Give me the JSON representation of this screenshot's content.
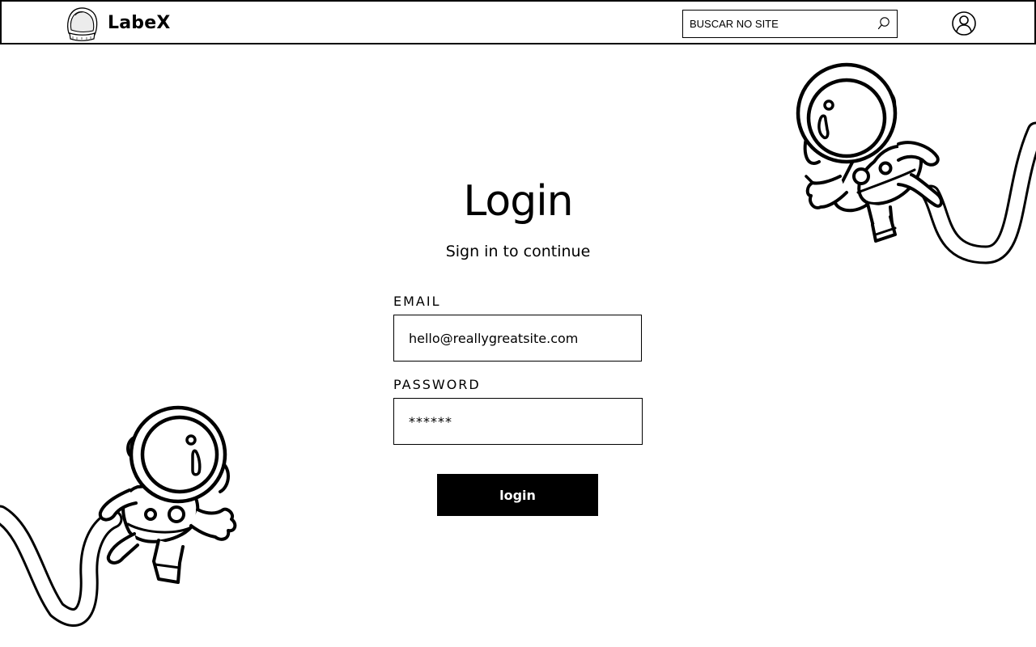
{
  "header": {
    "brand": "LabeX",
    "logo_icon": "astronaut-helmet-icon",
    "search": {
      "placeholder": "BUSCAR NO SITE",
      "icon": "search-icon"
    },
    "user_icon": "user-icon"
  },
  "login": {
    "title": "Login",
    "subtitle": "Sign in to continue",
    "email_label": "EMAIL",
    "email_value": "hello@reallygreatsite.com",
    "password_label": "PASSWORD",
    "password_value": "******",
    "submit_label": "login"
  },
  "decorations": [
    "astronaut-illustration",
    "astronaut-illustration"
  ],
  "colors": {
    "background": "#ffffff",
    "foreground": "#000000",
    "button_background": "#000000",
    "button_text": "#ffffff"
  }
}
